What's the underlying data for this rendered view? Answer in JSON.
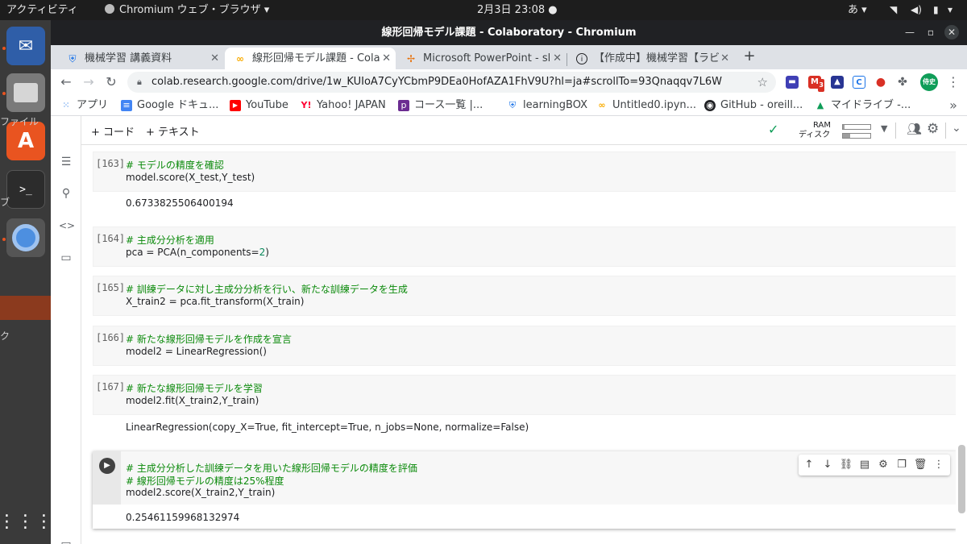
{
  "topbar": {
    "activities": "アクティビティ",
    "app_name": "Chromium ウェブ・ブラウザ ▾",
    "clock": "2月3日  23:08",
    "input_method": "あ ▾"
  },
  "window": {
    "title": "線形回帰モデル課題 - Colaboratory - Chromium"
  },
  "tabs": [
    {
      "label": "機械学習 講義資料"
    },
    {
      "label": "線形回帰モデル課題 - Cola"
    },
    {
      "label": "Microsoft PowerPoint - sl"
    },
    {
      "label": "【作成中】機械学習【ラビ"
    }
  ],
  "toolbar": {
    "url": "colab.research.google.com/drive/1w_KUIoA7CyYCbmP9DEa0HofAZA1FhV9U?hl=ja#scrollTo=93Qnaqqv7L6W",
    "mail_badge": "3",
    "profile": "侍史"
  },
  "bookmarks": [
    {
      "label": "アプリ"
    },
    {
      "label": "Google ドキュ..."
    },
    {
      "label": "YouTube"
    },
    {
      "label": "Yahoo! JAPAN"
    },
    {
      "label": "コース一覧 |..."
    },
    {
      "label": "learningBOX"
    },
    {
      "label": "Untitled0.ipyn..."
    },
    {
      "label": "GitHub - oreill..."
    },
    {
      "label": "マイドライブ -..."
    }
  ],
  "colab": {
    "add_code": "+ コード",
    "add_text": "+ テキスト",
    "ram_label": "RAM",
    "disk_label": "ディスク",
    "ram_usage": 0.05,
    "disk_usage": 0.25
  },
  "ghost": {
    "file": "ファイル",
    "ku": "ク",
    "bu": "ブ"
  },
  "cells": [
    {
      "exec": "[163]",
      "lines": [
        "# モデルの精度を確認",
        "model.score(X_test,Y_test)"
      ],
      "output": "0.6733825506400194"
    },
    {
      "exec": "[164]",
      "lines": [
        "# 主成分分析を適用",
        "pca = PCA(n_components=",
        "2",
        ")"
      ],
      "output": ""
    },
    {
      "exec": "[165]",
      "lines": [
        "# 訓練データに対し主成分分析を行い、新たな訓練データを生成",
        "X_train2 = pca.fit_transform(X_train)"
      ],
      "output": ""
    },
    {
      "exec": "[166]",
      "lines": [
        "# 新たな線形回帰モデルを作成を宣言",
        "model2 = LinearRegression()"
      ],
      "output": ""
    },
    {
      "exec": "[167]",
      "lines": [
        "# 新たな線形回帰モデルを学習",
        "model2.fit(X_train2,Y_train)"
      ],
      "output": "LinearRegression(copy_X=True, fit_intercept=True, n_jobs=None, normalize=False)"
    },
    {
      "exec": "",
      "lines": [
        "# 主成分分析した訓練データを用いた線形回帰モデルの精度を評価",
        "# 線形回帰モデルの精度は25%程度",
        "model2.score(X_train2,Y_train)"
      ],
      "output": "0.25461159968132974"
    }
  ]
}
